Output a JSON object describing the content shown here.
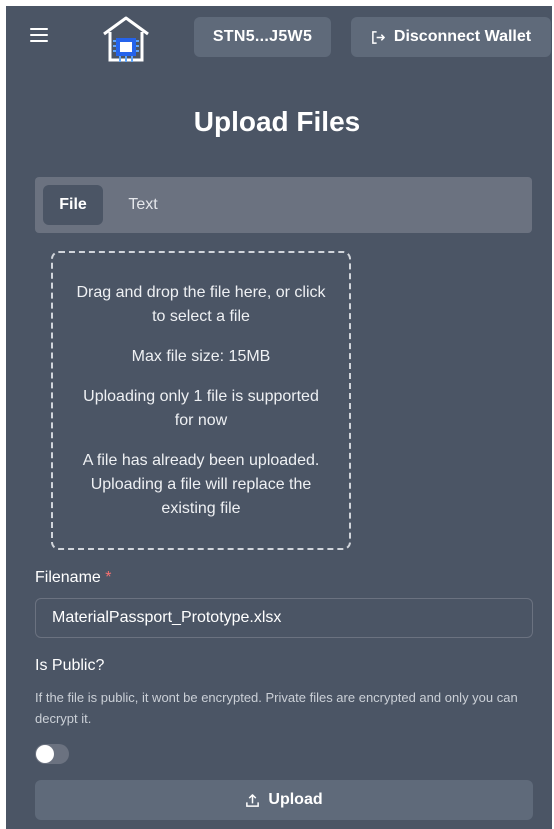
{
  "header": {
    "menu_icon": "hamburger-menu-icon",
    "logo_icon": "house-chip-logo",
    "wallet_address": "STN5...J5W5",
    "disconnect_label": "Disconnect Wallet",
    "disconnect_icon": "logout-icon"
  },
  "page": {
    "title": "Upload Files"
  },
  "tabs": [
    {
      "label": "File",
      "active": true
    },
    {
      "label": "Text",
      "active": false
    }
  ],
  "dropzone": {
    "instruction": "Drag and drop the file here, or click to select a file",
    "max_size": "Max file size: 15MB",
    "single_file_note": "Uploading only 1 file is supported for now",
    "replace_note": "A file has already been uploaded. Uploading a file will replace the existing file"
  },
  "form": {
    "filename_label": "Filename",
    "required_mark": "*",
    "filename_value": "MaterialPassport_Prototype.xlsx",
    "public_label": "Is Public?",
    "public_helper": "If the file is public, it wont be encrypted. Private files are encrypted and only you can decrypt it.",
    "is_public": false,
    "upload_label": "Upload",
    "upload_icon": "upload-icon"
  },
  "colors": {
    "background": "#4b5565",
    "surface": "#5f6a7a",
    "tab_bar": "#6b7280",
    "required": "#f87171"
  }
}
